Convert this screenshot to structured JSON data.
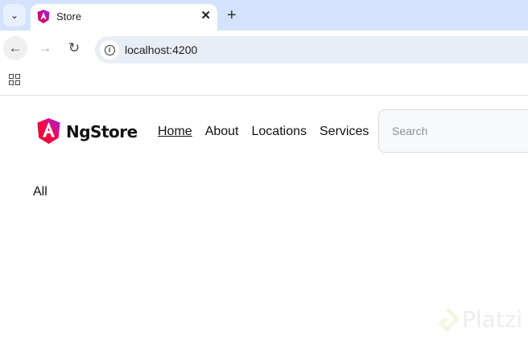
{
  "browser": {
    "tab_title": "Store",
    "url": "localhost:4200",
    "icons": {
      "tab_menu": "chevron-down-icon",
      "close": "close-icon",
      "new_tab": "plus-icon",
      "back": "arrow-left-icon",
      "forward": "arrow-right-icon",
      "reload": "reload-icon",
      "site_info": "info-icon",
      "apps": "apps-grid-icon"
    }
  },
  "header": {
    "brand": "NgStore",
    "nav": [
      {
        "label": "Home",
        "active": true
      },
      {
        "label": "About"
      },
      {
        "label": "Locations"
      },
      {
        "label": "Services"
      }
    ],
    "search_placeholder": "Search"
  },
  "main": {
    "category": "All"
  },
  "watermark": "Platzi",
  "colors": {
    "tabstrip": "#d3e3fd",
    "omnibox": "#e9eef6",
    "logo_start": "#e40035",
    "logo_end": "#9c1fec"
  }
}
